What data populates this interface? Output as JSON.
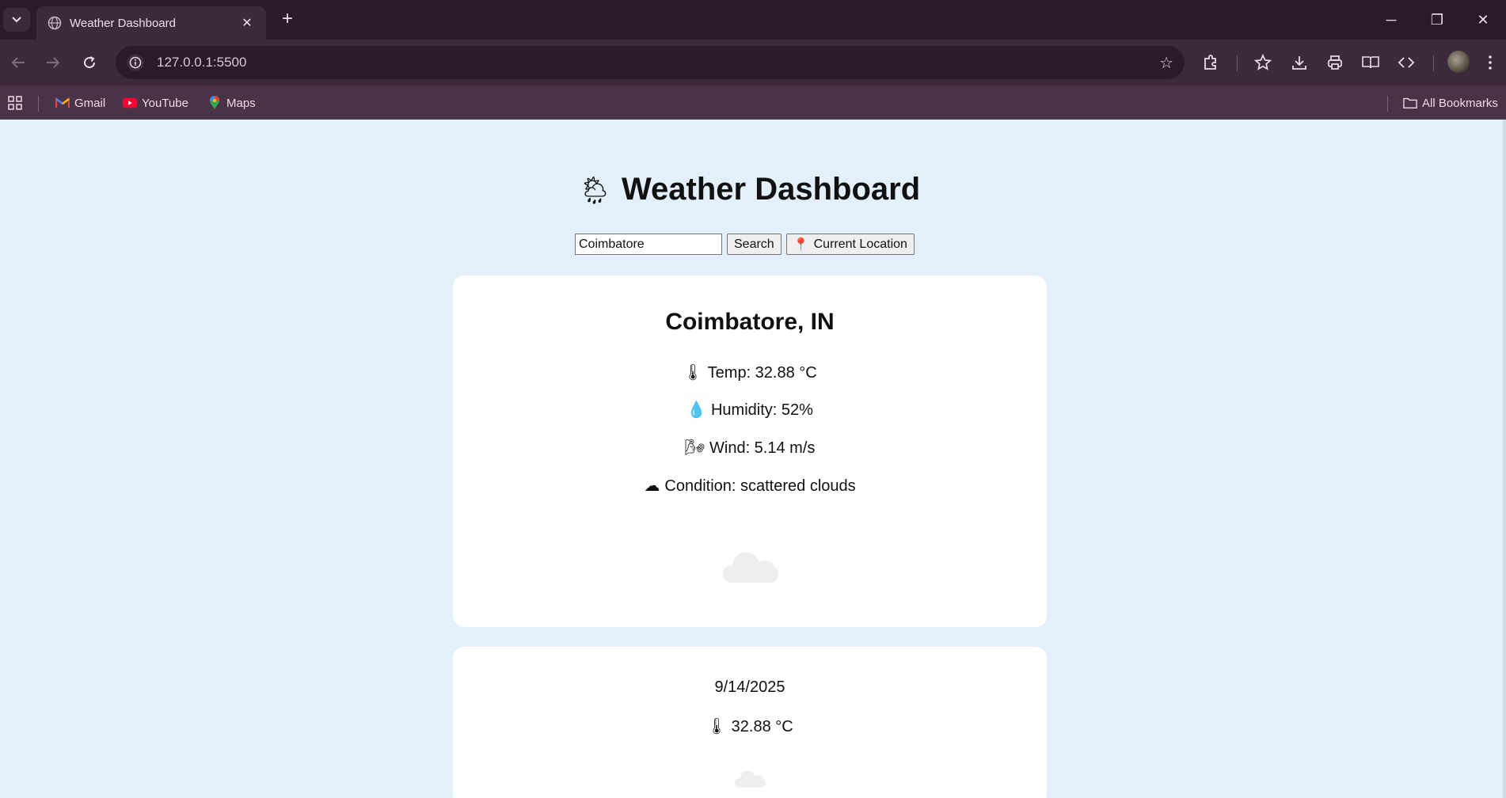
{
  "browser": {
    "tab_title": "Weather Dashboard",
    "url": "127.0.0.1:5500",
    "bookmarks": [
      {
        "label": "Gmail",
        "icon": "gmail-icon"
      },
      {
        "label": "YouTube",
        "icon": "youtube-icon"
      },
      {
        "label": "Maps",
        "icon": "maps-icon"
      }
    ],
    "all_bookmarks_label": "All Bookmarks",
    "theme_color": "#2a1b28"
  },
  "page": {
    "title": "Weather Dashboard",
    "title_icon": "🌦",
    "search_value": "Coimbatore",
    "search_button": "Search",
    "location_button": "Current Location",
    "location_icon": "📍",
    "background": "#e3f0fb"
  },
  "current": {
    "city": "Coimbatore, IN",
    "temp_icon": "🌡",
    "temp": "Temp: 32.88 °C",
    "humidity_icon": "💧",
    "humidity": "Humidity: 52%",
    "wind_icon": "🌬",
    "wind": "Wind: 5.14 m/s",
    "condition_icon": "☁",
    "condition": "Condition: scattered clouds",
    "image_icon": "cloud-icon"
  },
  "forecast": [
    {
      "date": "9/14/2025",
      "temp_icon": "🌡",
      "temp": "32.88 °C",
      "image_icon": "cloud-icon"
    }
  ]
}
